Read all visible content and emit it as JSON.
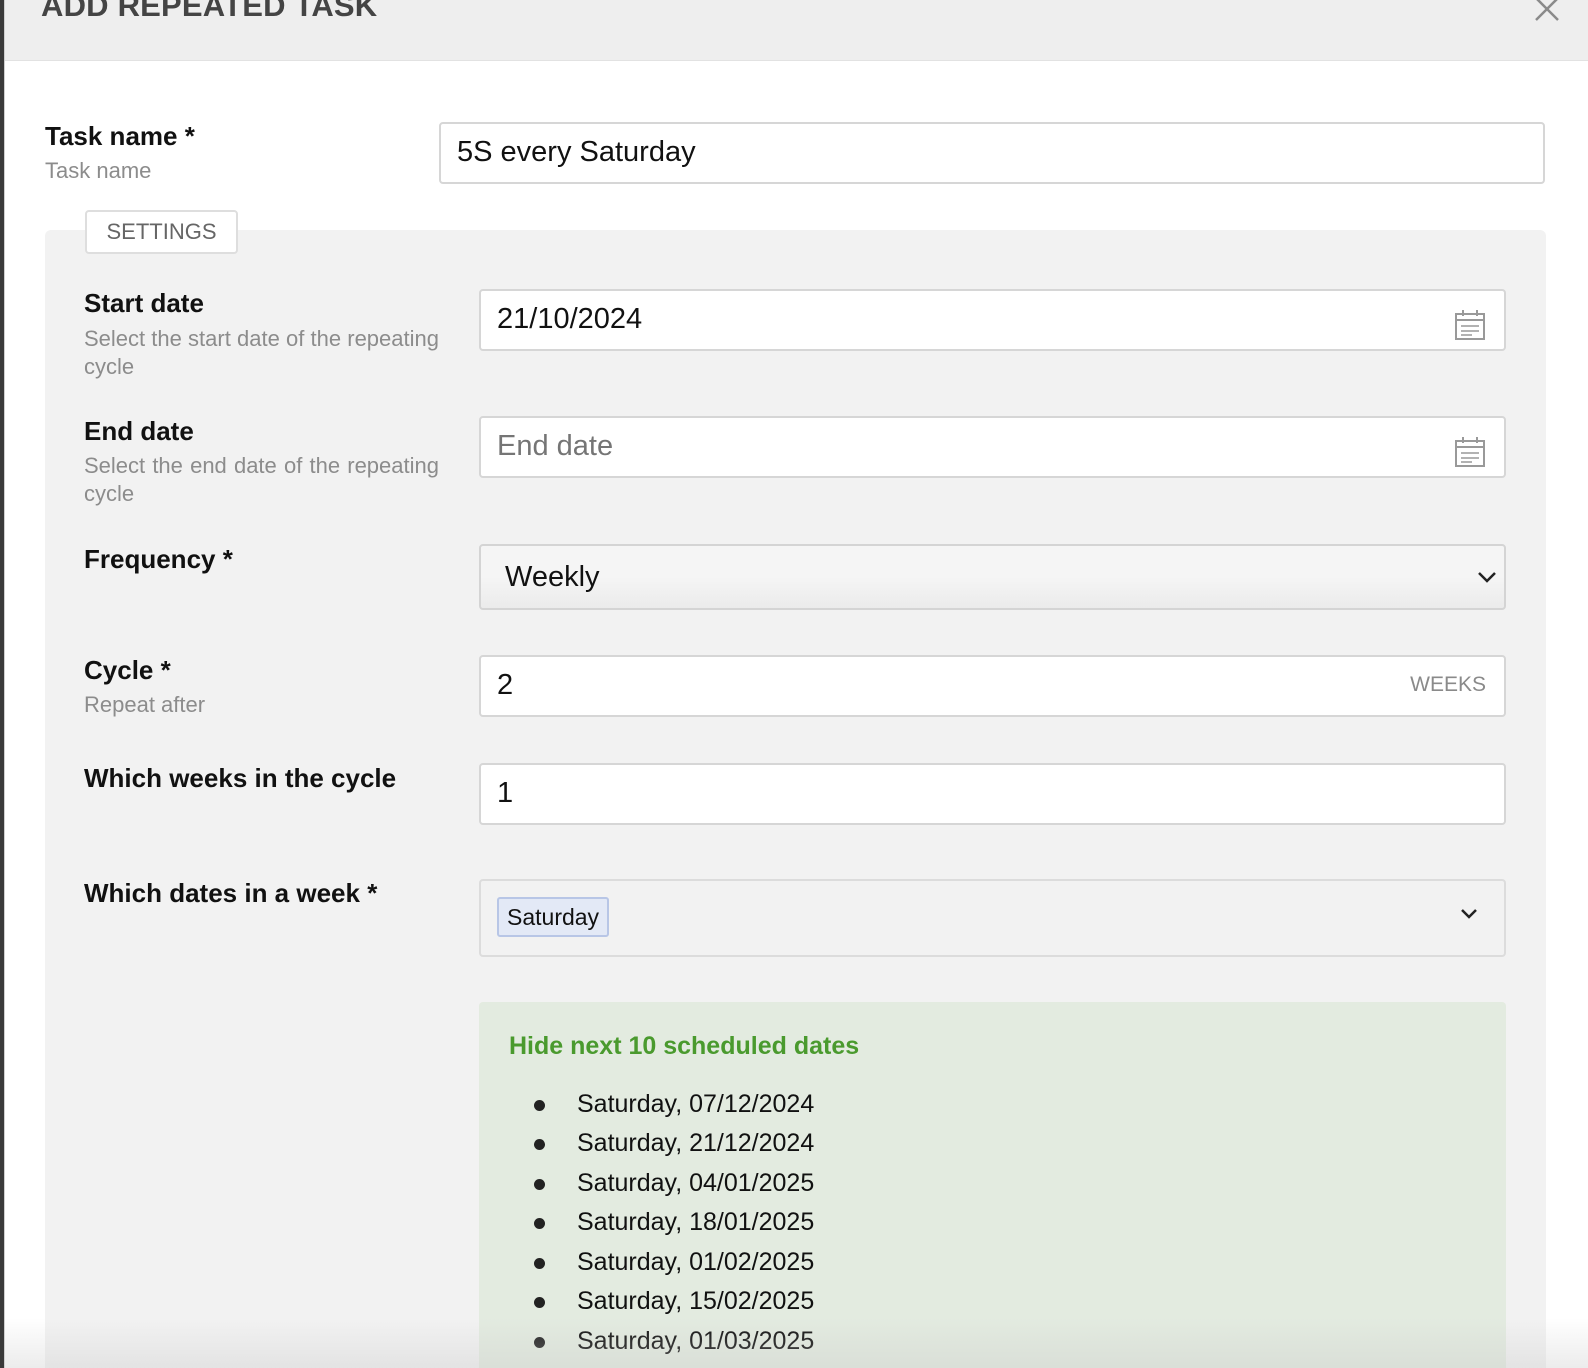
{
  "dialog": {
    "title": "ADD REPEATED TASK"
  },
  "task_name": {
    "label": "Task name *",
    "hint": "Task name",
    "value": "5S every Saturday"
  },
  "settings": {
    "tab_label": "SETTINGS",
    "start_date": {
      "label": "Start date",
      "hint": "Select the start date of the repeating cycle",
      "value": "21/10/2024"
    },
    "end_date": {
      "label": "End date",
      "hint": "Select the end date of the repeating cycle",
      "placeholder": "End date",
      "value": ""
    },
    "frequency": {
      "label": "Frequency *",
      "value": "Weekly"
    },
    "cycle": {
      "label": "Cycle *",
      "hint": "Repeat after",
      "value": "2",
      "unit": "WEEKS"
    },
    "weeks_in_cycle": {
      "label": "Which weeks in the cycle",
      "value": "1"
    },
    "dates_in_week": {
      "label": "Which dates in a week *",
      "selected": [
        "Saturday"
      ]
    },
    "schedule": {
      "toggle_label": "Hide next 10 scheduled dates",
      "dates": [
        "Saturday, 07/12/2024",
        "Saturday, 21/12/2024",
        "Saturday, 04/01/2025",
        "Saturday, 18/01/2025",
        "Saturday, 01/02/2025",
        "Saturday, 15/02/2025",
        "Saturday, 01/03/2025"
      ]
    }
  },
  "icons": {
    "close": "close-icon",
    "calendar": "calendar-icon",
    "dropdown": "chevron-down-icon"
  },
  "colors": {
    "accent_green": "#4a9a2e",
    "schedule_bg": "#e3ebe0",
    "chip_bg": "#e3e9f6"
  }
}
